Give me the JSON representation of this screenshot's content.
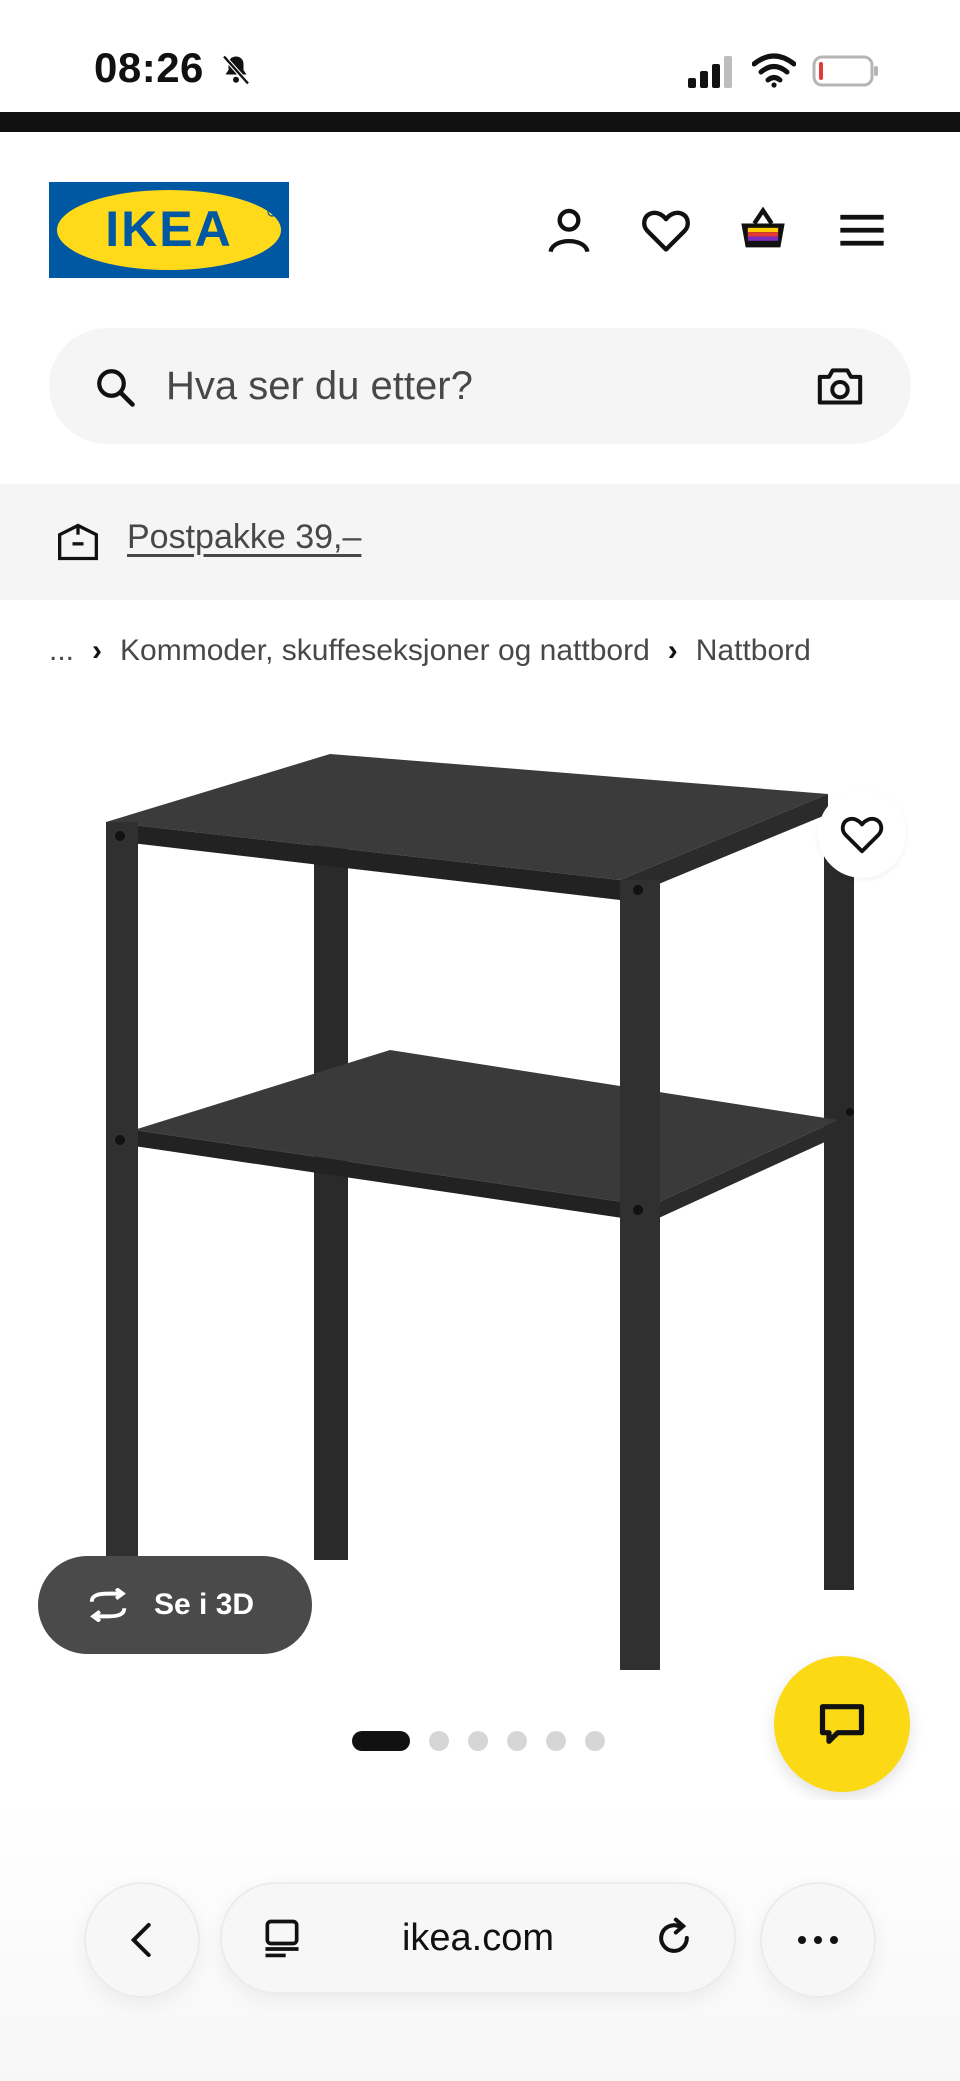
{
  "status_bar": {
    "time": "08:26"
  },
  "header": {
    "logo_text": "IKEA",
    "logo_colors": {
      "blue": "#0058a3",
      "yellow": "#ffda1a"
    }
  },
  "search": {
    "placeholder": "Hva ser du etter?"
  },
  "promo": {
    "label": "Postpakke 39,–"
  },
  "breadcrumb": {
    "ellipsis": "...",
    "items": [
      "Kommoder, skuffeseksjoner og nattbord",
      "Nattbord"
    ]
  },
  "product": {
    "view_3d_label": "Se i 3D",
    "image_count": 6,
    "active_image": 1
  },
  "browser": {
    "url": "ikea.com"
  },
  "colors": {
    "accent_yellow": "#fbd914",
    "text_dark": "#111111",
    "muted": "#484848"
  }
}
